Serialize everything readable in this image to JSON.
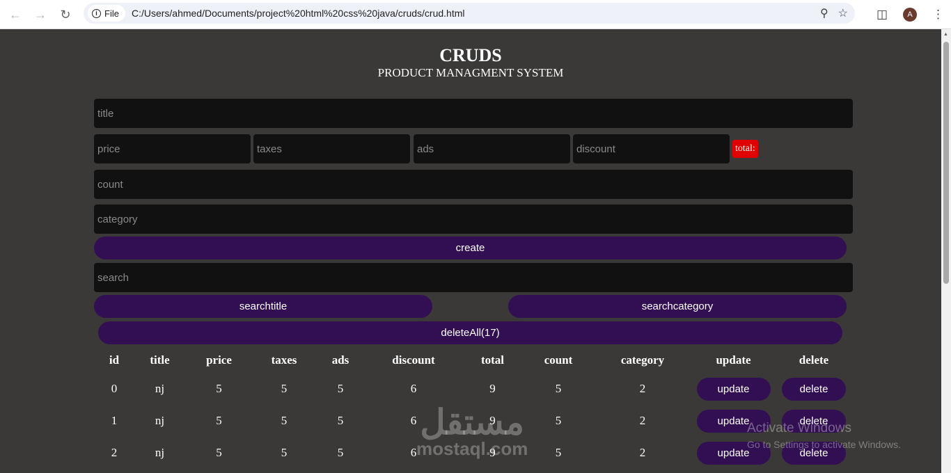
{
  "browser": {
    "site_chip": "File",
    "url": "C:/Users/ahmed/Documents/project%20html%20css%20java/cruds/crud.html",
    "avatar_letter": "A"
  },
  "header": {
    "title": "CRUDS",
    "subtitle": "PRODUCT MANAGMENT SYSTEM"
  },
  "form": {
    "title_placeholder": "title",
    "price_placeholder": "price",
    "taxes_placeholder": "taxes",
    "ads_placeholder": "ads",
    "discount_placeholder": "discount",
    "total_label": "total:",
    "count_placeholder": "count",
    "category_placeholder": "category",
    "create_label": "create"
  },
  "search": {
    "placeholder": "search",
    "by_title_label": "searchtitle",
    "by_category_label": "searchcategory"
  },
  "delete_all_label": "deleteAll(17)",
  "table": {
    "headers": [
      "id",
      "title",
      "price",
      "taxes",
      "ads",
      "discount",
      "total",
      "count",
      "category",
      "update",
      "delete"
    ],
    "rows": [
      {
        "id": "0",
        "title": "nj",
        "price": "5",
        "taxes": "5",
        "ads": "5",
        "discount": "6",
        "total": "9",
        "count": "5",
        "category": "2",
        "update": "update",
        "delete": "delete"
      },
      {
        "id": "1",
        "title": "nj",
        "price": "5",
        "taxes": "5",
        "ads": "5",
        "discount": "6",
        "total": "9",
        "count": "5",
        "category": "2",
        "update": "update",
        "delete": "delete"
      },
      {
        "id": "2",
        "title": "nj",
        "price": "5",
        "taxes": "5",
        "ads": "5",
        "discount": "6",
        "total": "9",
        "count": "5",
        "category": "2",
        "update": "update",
        "delete": "delete"
      }
    ]
  },
  "overlay": {
    "activate_title": "Activate Windows",
    "activate_sub": "Go to Settings to activate Windows.",
    "watermark_arabic": "مستقل",
    "watermark_latin": "mostaql.com"
  },
  "colors": {
    "page_bg": "#3b3938",
    "input_bg": "#111111",
    "button_bg": "#320f53",
    "total_bg": "#e00000"
  }
}
